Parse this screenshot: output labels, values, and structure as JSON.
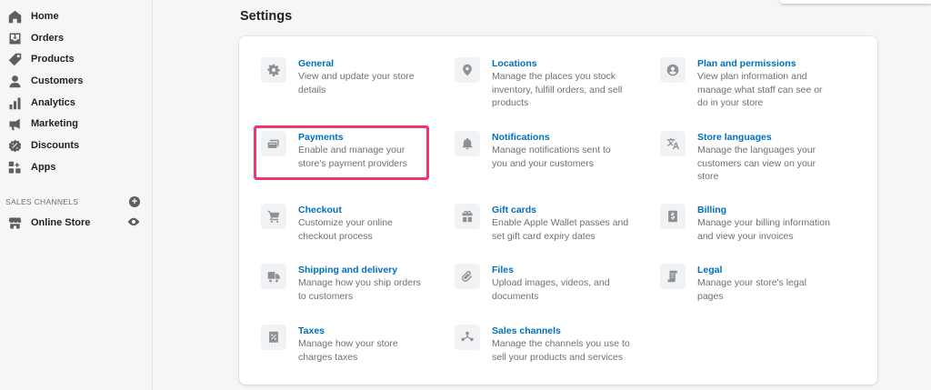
{
  "sidebar": {
    "items": [
      {
        "label": "Home",
        "icon": "home-icon"
      },
      {
        "label": "Orders",
        "icon": "orders-icon"
      },
      {
        "label": "Products",
        "icon": "tag-icon"
      },
      {
        "label": "Customers",
        "icon": "person-icon"
      },
      {
        "label": "Analytics",
        "icon": "bar-chart-icon"
      },
      {
        "label": "Marketing",
        "icon": "megaphone-icon"
      },
      {
        "label": "Discounts",
        "icon": "discount-icon"
      },
      {
        "label": "Apps",
        "icon": "apps-icon"
      }
    ],
    "sales_channels_label": "SALES CHANNELS",
    "add_channel_symbol": "+",
    "online_store_label": "Online Store"
  },
  "main": {
    "title": "Settings",
    "highlight_color": "#f0386b",
    "settings": [
      {
        "title": "General",
        "description": "View and update your store details",
        "icon": "gear-icon"
      },
      {
        "title": "Locations",
        "description": "Manage the places you stock inventory, fulfill orders, and sell products",
        "icon": "location-pin-icon"
      },
      {
        "title": "Plan and permissions",
        "description": "View plan information and manage what staff can see or do in your store",
        "icon": "account-icon"
      },
      {
        "title": "Payments",
        "description": "Enable and manage your store's payment providers",
        "icon": "payment-card-icon"
      },
      {
        "title": "Notifications",
        "description": "Manage notifications sent to you and your customers",
        "icon": "bell-icon"
      },
      {
        "title": "Store languages",
        "description": "Manage the languages your customers can view on your store",
        "icon": "translate-icon"
      },
      {
        "title": "Checkout",
        "description": "Customize your online checkout process",
        "icon": "cart-icon"
      },
      {
        "title": "Gift cards",
        "description": "Enable Apple Wallet passes and set gift card expiry dates",
        "icon": "gift-icon"
      },
      {
        "title": "Billing",
        "description": "Manage your billing information and view your invoices",
        "icon": "billing-icon"
      },
      {
        "title": "Shipping and delivery",
        "description": "Manage how you ship orders to customers",
        "icon": "truck-icon"
      },
      {
        "title": "Files",
        "description": "Upload images, videos, and documents",
        "icon": "paperclip-icon"
      },
      {
        "title": "Legal",
        "description": "Manage your store's legal pages",
        "icon": "legal-icon"
      },
      {
        "title": "Taxes",
        "description": "Manage how your store charges taxes",
        "icon": "tax-receipt-icon"
      },
      {
        "title": "Sales channels",
        "description": "Manage the channels you use to sell your products and services",
        "icon": "channels-icon"
      }
    ]
  }
}
